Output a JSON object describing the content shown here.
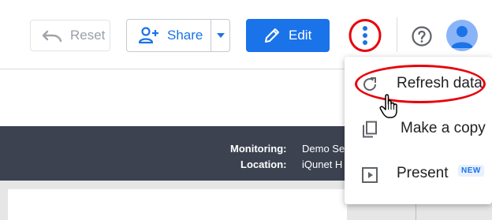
{
  "toolbar": {
    "reset_label": "Reset",
    "share_label": "Share",
    "edit_label": "Edit"
  },
  "report_header": {
    "monitoring_label": "Monitoring:",
    "monitoring_value": "Demo Se",
    "location_label": "Location:",
    "location_value": "iQunet H"
  },
  "menu": {
    "items": [
      {
        "label": "Refresh data",
        "icon": "refresh-icon"
      },
      {
        "label": "Make a copy",
        "icon": "copy-icon"
      },
      {
        "label": "Present",
        "icon": "present-icon",
        "badge": "NEW"
      }
    ]
  },
  "colors": {
    "primary": "#1a73e8",
    "highlight": "#e8000b",
    "report_bar": "#3c4250"
  }
}
